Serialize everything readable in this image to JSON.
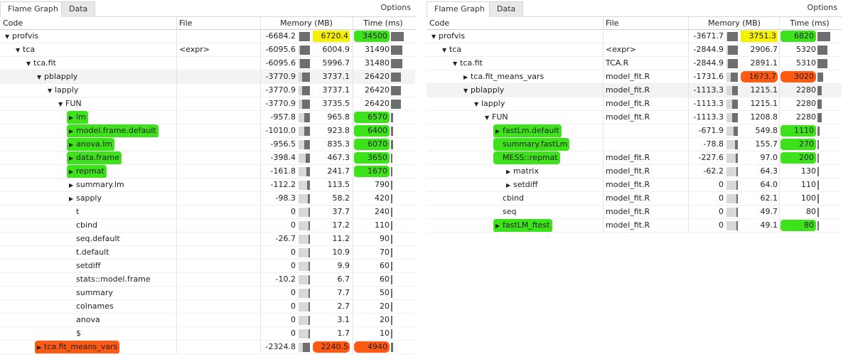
{
  "colors": {
    "green": "#3ee21b",
    "orange": "#ff5a14",
    "yellow": "#f5f100",
    "bar": "#6e6e6e"
  },
  "left": {
    "tabs": [
      {
        "label": "Flame Graph",
        "active": true
      },
      {
        "label": "Data",
        "active": false
      }
    ],
    "options_label": "Options",
    "headers": {
      "code": "Code",
      "file": "File",
      "memory": "Memory (MB)",
      "time": "Time (ms)"
    },
    "rows": [
      {
        "indent": 0,
        "arrow": "down",
        "label": "profvis",
        "file": "",
        "mem_neg": "-6684.2",
        "mem_pos": "6720.4",
        "mem_frac": 0.95,
        "time": "34500",
        "time_frac": 1.0,
        "shade": false,
        "hl_mem": "yellow",
        "hl_time": "green",
        "hl_code": ""
      },
      {
        "indent": 1,
        "arrow": "down",
        "label": "tca",
        "file": "<expr>",
        "mem_neg": "-6095.6",
        "mem_pos": "6004.9",
        "mem_frac": 0.9,
        "time": "31490",
        "time_frac": 0.91,
        "shade": false,
        "hl_mem": "",
        "hl_time": "",
        "hl_code": ""
      },
      {
        "indent": 2,
        "arrow": "down",
        "label": "tca.fit",
        "file": "",
        "mem_neg": "-6095.6",
        "mem_pos": "5996.7",
        "mem_frac": 0.9,
        "time": "31480",
        "time_frac": 0.91,
        "shade": false,
        "hl_mem": "",
        "hl_time": "",
        "hl_code": ""
      },
      {
        "indent": 3,
        "arrow": "down",
        "label": "pblapply",
        "file": "",
        "mem_neg": "-3770.9",
        "mem_pos": "3737.1",
        "mem_frac": 0.7,
        "time": "26420",
        "time_frac": 0.77,
        "shade": true,
        "hl_mem": "",
        "hl_time": "",
        "hl_code": ""
      },
      {
        "indent": 4,
        "arrow": "down",
        "label": "lapply",
        "file": "",
        "mem_neg": "-3770.9",
        "mem_pos": "3737.1",
        "mem_frac": 0.7,
        "time": "26420",
        "time_frac": 0.77,
        "shade": false,
        "hl_mem": "",
        "hl_time": "",
        "hl_code": ""
      },
      {
        "indent": 5,
        "arrow": "down",
        "label": "FUN",
        "file": "",
        "mem_neg": "-3770.9",
        "mem_pos": "3735.5",
        "mem_frac": 0.7,
        "time": "26420",
        "time_frac": 0.77,
        "shade": false,
        "hl_mem": "",
        "hl_time": "",
        "hl_code": ""
      },
      {
        "indent": 6,
        "arrow": "right",
        "label": "lm",
        "file": "",
        "mem_neg": "-957.8",
        "mem_pos": "965.8",
        "mem_frac": 0.5,
        "time": "6570",
        "time_frac": 0.19,
        "shade": false,
        "hl_mem": "",
        "hl_time": "green",
        "hl_code": "green"
      },
      {
        "indent": 6,
        "arrow": "right",
        "label": "model.frame.default",
        "file": "",
        "mem_neg": "-1010.0",
        "mem_pos": "923.8",
        "mem_frac": 0.5,
        "time": "6400",
        "time_frac": 0.18,
        "shade": false,
        "hl_mem": "",
        "hl_time": "green",
        "hl_code": "green"
      },
      {
        "indent": 6,
        "arrow": "right",
        "label": "anova.lm",
        "file": "",
        "mem_neg": "-956.5",
        "mem_pos": "835.3",
        "mem_frac": 0.5,
        "time": "6070",
        "time_frac": 0.17,
        "shade": false,
        "hl_mem": "",
        "hl_time": "green",
        "hl_code": "green"
      },
      {
        "indent": 6,
        "arrow": "right",
        "label": "data.frame",
        "file": "",
        "mem_neg": "-398.4",
        "mem_pos": "467.3",
        "mem_frac": 0.4,
        "time": "3650",
        "time_frac": 0.1,
        "shade": false,
        "hl_mem": "",
        "hl_time": "green",
        "hl_code": "green"
      },
      {
        "indent": 6,
        "arrow": "right",
        "label": "repmat",
        "file": "",
        "mem_neg": "-161.8",
        "mem_pos": "241.7",
        "mem_frac": 0.3,
        "time": "1670",
        "time_frac": 0.05,
        "shade": false,
        "hl_mem": "",
        "hl_time": "green",
        "hl_code": "green"
      },
      {
        "indent": 6,
        "arrow": "right",
        "label": "summary.lm",
        "file": "",
        "mem_neg": "-112.2",
        "mem_pos": "113.5",
        "mem_frac": 0.25,
        "time": "790",
        "time_frac": 0.03,
        "shade": false,
        "hl_mem": "",
        "hl_time": "",
        "hl_code": ""
      },
      {
        "indent": 6,
        "arrow": "right",
        "label": "sapply",
        "file": "",
        "mem_neg": "-98.3",
        "mem_pos": "58.2",
        "mem_frac": 0.2,
        "time": "420",
        "time_frac": 0.02,
        "shade": false,
        "hl_mem": "",
        "hl_time": "",
        "hl_code": ""
      },
      {
        "indent": 6,
        "arrow": "",
        "label": "t",
        "file": "",
        "mem_neg": "0",
        "mem_pos": "37.7",
        "mem_frac": 0.1,
        "time": "240",
        "time_frac": 0.01,
        "shade": false,
        "hl_mem": "",
        "hl_time": "",
        "hl_code": ""
      },
      {
        "indent": 6,
        "arrow": "",
        "label": "cbind",
        "file": "",
        "mem_neg": "0",
        "mem_pos": "17.2",
        "mem_frac": 0.1,
        "time": "110",
        "time_frac": 0.01,
        "shade": false,
        "hl_mem": "",
        "hl_time": "",
        "hl_code": ""
      },
      {
        "indent": 6,
        "arrow": "",
        "label": "seq.default",
        "file": "",
        "mem_neg": "-26.7",
        "mem_pos": "11.2",
        "mem_frac": 0.1,
        "time": "90",
        "time_frac": 0.01,
        "shade": false,
        "hl_mem": "",
        "hl_time": "",
        "hl_code": ""
      },
      {
        "indent": 6,
        "arrow": "",
        "label": "t.default",
        "file": "",
        "mem_neg": "0",
        "mem_pos": "10.9",
        "mem_frac": 0.1,
        "time": "70",
        "time_frac": 0.01,
        "shade": false,
        "hl_mem": "",
        "hl_time": "",
        "hl_code": ""
      },
      {
        "indent": 6,
        "arrow": "",
        "label": "setdiff",
        "file": "",
        "mem_neg": "0",
        "mem_pos": "9.9",
        "mem_frac": 0.1,
        "time": "60",
        "time_frac": 0.01,
        "shade": false,
        "hl_mem": "",
        "hl_time": "",
        "hl_code": ""
      },
      {
        "indent": 6,
        "arrow": "",
        "label": "stats::model.frame",
        "file": "",
        "mem_neg": "-10.2",
        "mem_pos": "6.7",
        "mem_frac": 0.1,
        "time": "60",
        "time_frac": 0.01,
        "shade": false,
        "hl_mem": "",
        "hl_time": "",
        "hl_code": ""
      },
      {
        "indent": 6,
        "arrow": "",
        "label": "summary",
        "file": "",
        "mem_neg": "0",
        "mem_pos": "7.7",
        "mem_frac": 0.1,
        "time": "50",
        "time_frac": 0.01,
        "shade": false,
        "hl_mem": "",
        "hl_time": "",
        "hl_code": ""
      },
      {
        "indent": 6,
        "arrow": "",
        "label": "colnames",
        "file": "",
        "mem_neg": "0",
        "mem_pos": "2.7",
        "mem_frac": 0.05,
        "time": "20",
        "time_frac": 0.0,
        "shade": false,
        "hl_mem": "",
        "hl_time": "",
        "hl_code": ""
      },
      {
        "indent": 6,
        "arrow": "",
        "label": "anova",
        "file": "",
        "mem_neg": "0",
        "mem_pos": "3.1",
        "mem_frac": 0.05,
        "time": "20",
        "time_frac": 0.0,
        "shade": false,
        "hl_mem": "",
        "hl_time": "",
        "hl_code": ""
      },
      {
        "indent": 6,
        "arrow": "",
        "label": "$",
        "file": "",
        "mem_neg": "0",
        "mem_pos": "1.7",
        "mem_frac": 0.05,
        "time": "10",
        "time_frac": 0.0,
        "shade": false,
        "hl_mem": "",
        "hl_time": "",
        "hl_code": ""
      },
      {
        "indent": 3,
        "arrow": "right",
        "label": "tca.fit_means_vars",
        "file": "",
        "mem_neg": "-2324.8",
        "mem_pos": "2240.5",
        "mem_frac": 0.6,
        "time": "4940",
        "time_frac": 0.14,
        "shade": false,
        "hl_mem": "orange",
        "hl_time": "orange",
        "hl_code": "orange"
      }
    ]
  },
  "right": {
    "tabs": [
      {
        "label": "Flame Graph",
        "active": true
      },
      {
        "label": "Data",
        "active": false
      }
    ],
    "options_label": "Options",
    "headers": {
      "code": "Code",
      "file": "File",
      "memory": "Memory (MB)",
      "time": "Time (ms)"
    },
    "rows": [
      {
        "indent": 0,
        "arrow": "down",
        "label": "profvis",
        "file": "",
        "mem_neg": "-3671.7",
        "mem_pos": "3751.3",
        "mem_frac": 0.95,
        "time": "6820",
        "time_frac": 1.0,
        "shade": false,
        "hl_mem": "yellow",
        "hl_time": "green",
        "hl_code": ""
      },
      {
        "indent": 1,
        "arrow": "down",
        "label": "tca",
        "file": "<expr>",
        "mem_neg": "-2844.9",
        "mem_pos": "2906.7",
        "mem_frac": 0.85,
        "time": "5320",
        "time_frac": 0.78,
        "shade": false,
        "hl_mem": "",
        "hl_time": "",
        "hl_code": ""
      },
      {
        "indent": 2,
        "arrow": "down",
        "label": "tca.fit",
        "file": "TCA.R",
        "mem_neg": "-2844.9",
        "mem_pos": "2891.1",
        "mem_frac": 0.85,
        "time": "5310",
        "time_frac": 0.78,
        "shade": false,
        "hl_mem": "",
        "hl_time": "",
        "hl_code": ""
      },
      {
        "indent": 3,
        "arrow": "right",
        "label": "tca.fit_means_vars",
        "file": "model_fit.R",
        "mem_neg": "-1731.6",
        "mem_pos": "1673.7",
        "mem_frac": 0.6,
        "time": "3020",
        "time_frac": 0.44,
        "shade": false,
        "hl_mem": "orange",
        "hl_time": "orange",
        "hl_code": ""
      },
      {
        "indent": 3,
        "arrow": "down",
        "label": "pblapply",
        "file": "model_fit.R",
        "mem_neg": "-1113.3",
        "mem_pos": "1215.1",
        "mem_frac": 0.5,
        "time": "2280",
        "time_frac": 0.33,
        "shade": true,
        "hl_mem": "",
        "hl_time": "",
        "hl_code": ""
      },
      {
        "indent": 4,
        "arrow": "down",
        "label": "lapply",
        "file": "model_fit.R",
        "mem_neg": "-1113.3",
        "mem_pos": "1215.1",
        "mem_frac": 0.5,
        "time": "2280",
        "time_frac": 0.33,
        "shade": false,
        "hl_mem": "",
        "hl_time": "",
        "hl_code": ""
      },
      {
        "indent": 5,
        "arrow": "down",
        "label": "FUN",
        "file": "model_fit.R",
        "mem_neg": "-1113.3",
        "mem_pos": "1208.8",
        "mem_frac": 0.5,
        "time": "2280",
        "time_frac": 0.33,
        "shade": false,
        "hl_mem": "",
        "hl_time": "",
        "hl_code": ""
      },
      {
        "indent": 6,
        "arrow": "right",
        "label": "fastLm.default",
        "file": "",
        "mem_neg": "-671.9",
        "mem_pos": "549.8",
        "mem_frac": 0.4,
        "time": "1110",
        "time_frac": 0.16,
        "shade": false,
        "hl_mem": "",
        "hl_time": "green",
        "hl_code": "green"
      },
      {
        "indent": 6,
        "arrow": "",
        "label": "summary.fastLm",
        "file": "",
        "mem_neg": "-78.8",
        "mem_pos": "155.7",
        "mem_frac": 0.25,
        "time": "270",
        "time_frac": 0.04,
        "shade": false,
        "hl_mem": "",
        "hl_time": "green",
        "hl_code": "green"
      },
      {
        "indent": 6,
        "arrow": "",
        "label": "MESS::repmat",
        "file": "model_fit.R",
        "mem_neg": "-227.6",
        "mem_pos": "97.0",
        "mem_frac": 0.2,
        "time": "200",
        "time_frac": 0.03,
        "shade": false,
        "hl_mem": "",
        "hl_time": "green",
        "hl_code": "green"
      },
      {
        "indent": 7,
        "arrow": "right",
        "label": "matrix",
        "file": "model_fit.R",
        "mem_neg": "-62.2",
        "mem_pos": "64.3",
        "mem_frac": 0.15,
        "time": "130",
        "time_frac": 0.02,
        "shade": false,
        "hl_mem": "",
        "hl_time": "",
        "hl_code": ""
      },
      {
        "indent": 7,
        "arrow": "right",
        "label": "setdiff",
        "file": "model_fit.R",
        "mem_neg": "0",
        "mem_pos": "64.0",
        "mem_frac": 0.15,
        "time": "110",
        "time_frac": 0.02,
        "shade": false,
        "hl_mem": "",
        "hl_time": "",
        "hl_code": ""
      },
      {
        "indent": 6,
        "arrow": "",
        "label": "cbind",
        "file": "model_fit.R",
        "mem_neg": "0",
        "mem_pos": "62.1",
        "mem_frac": 0.15,
        "time": "100",
        "time_frac": 0.01,
        "shade": false,
        "hl_mem": "",
        "hl_time": "",
        "hl_code": ""
      },
      {
        "indent": 6,
        "arrow": "",
        "label": "seq",
        "file": "model_fit.R",
        "mem_neg": "0",
        "mem_pos": "49.7",
        "mem_frac": 0.12,
        "time": "80",
        "time_frac": 0.01,
        "shade": false,
        "hl_mem": "",
        "hl_time": "",
        "hl_code": ""
      },
      {
        "indent": 6,
        "arrow": "right",
        "label": "fastLM_ftest",
        "file": "model_fit.R",
        "mem_neg": "0",
        "mem_pos": "49.1",
        "mem_frac": 0.12,
        "time": "80",
        "time_frac": 0.01,
        "shade": false,
        "hl_mem": "",
        "hl_time": "green",
        "hl_code": "green"
      }
    ]
  }
}
